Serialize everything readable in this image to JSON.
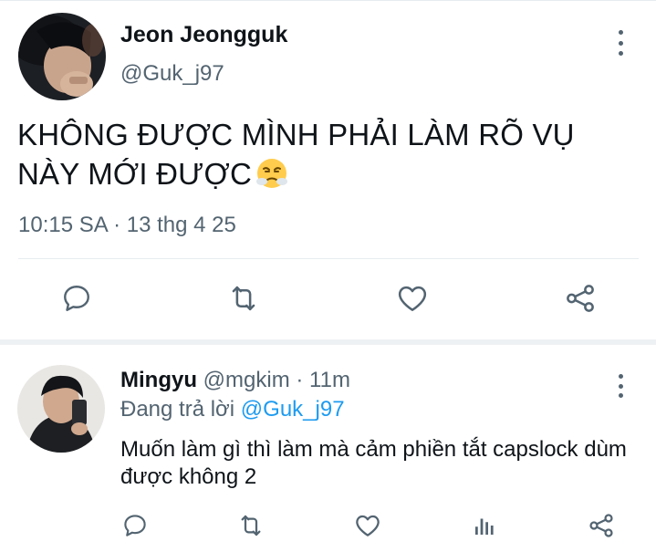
{
  "main_tweet": {
    "author_name": "Jeon Jeongguk",
    "author_handle": "@Guk_j97",
    "text": "KHÔNG ĐƯỢC MÌNH PHẢI LÀM RÕ VỤ NÀY MỚI ĐƯỢC",
    "emoji": "face-with-steam-from-nose",
    "timestamp": "10:15 SA · 13 thg 4 25",
    "actions": [
      "reply-icon",
      "retweet-icon",
      "like-icon",
      "share-icon"
    ]
  },
  "reply": {
    "author_name": "Mingyu",
    "author_handle": "@mgkim",
    "separator": " · ",
    "time": "11m",
    "replying_prefix": "Đang trả lời",
    "replying_to": "@Guk_j97",
    "text": "Muốn làm gì thì làm mà cảm phiền tắt capslock dùm được không 2",
    "actions": [
      "reply-icon",
      "retweet-icon",
      "like-icon",
      "analytics-icon",
      "share-icon"
    ]
  },
  "colors": {
    "text_primary": "#0f1419",
    "text_secondary": "#536471",
    "accent": "#1d9bf0",
    "divider": "#e6ecf0"
  }
}
